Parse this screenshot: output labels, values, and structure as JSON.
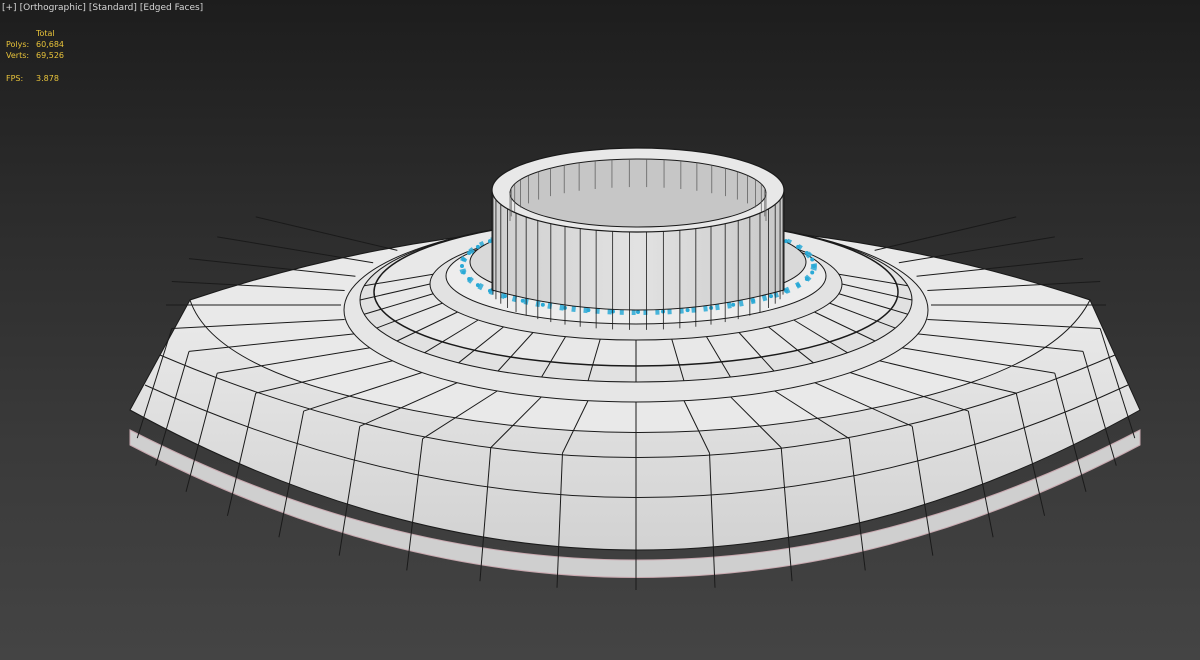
{
  "viewport": {
    "label_parts": [
      "[+]",
      "[Orthographic]",
      "[Standard]",
      "[Edged Faces]"
    ]
  },
  "stats": {
    "header": "Total",
    "polys_label": "Polys:",
    "polys_value": "60,684",
    "verts_label": "Verts:",
    "verts_value": "69,526",
    "fps_label": "FPS:",
    "fps_value": "3.878"
  },
  "scene": {
    "object": "disc-model",
    "edge_color": "#1a1a1a",
    "face_color": "#e4e4e4",
    "selection_color": "#2aa9d6",
    "background_top": "#1d1d1d",
    "background_bottom": "#444444"
  }
}
